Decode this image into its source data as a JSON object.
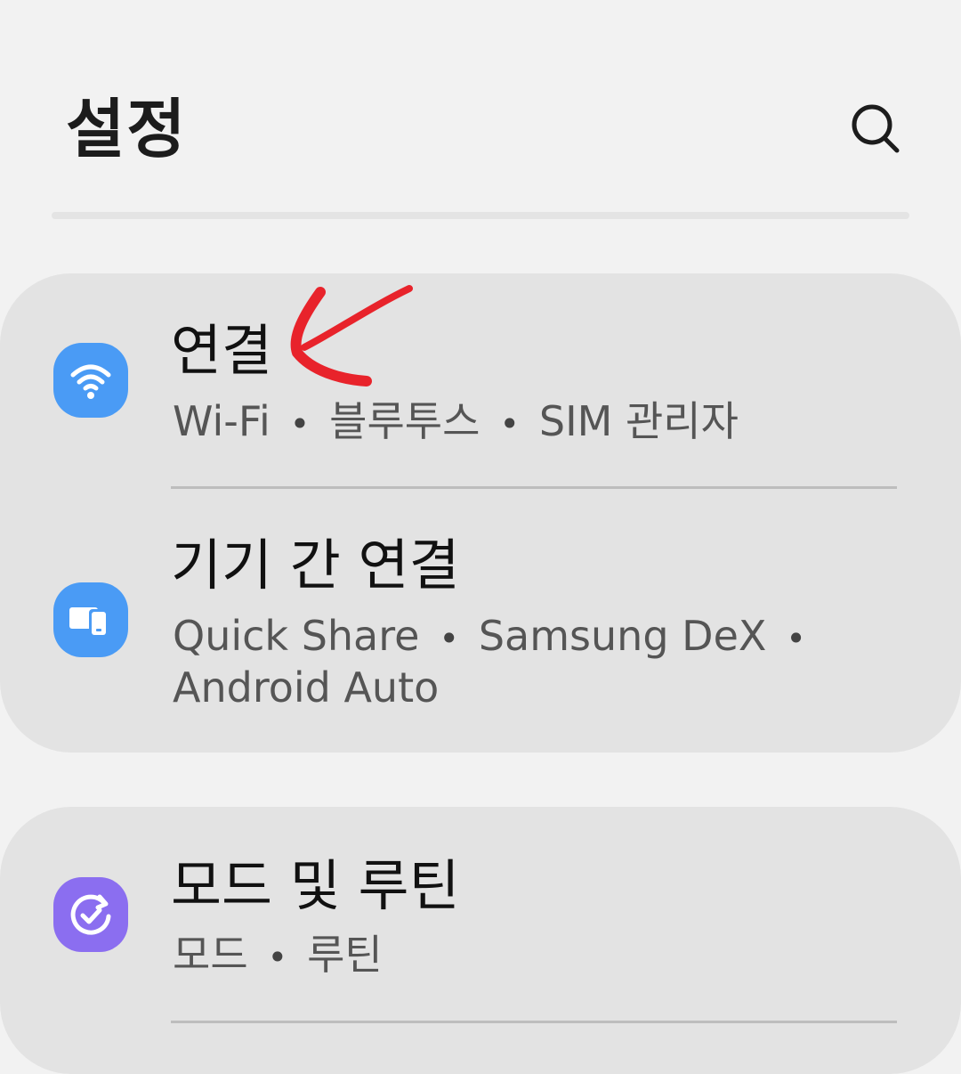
{
  "header": {
    "title": "설정",
    "search_icon": "search-icon"
  },
  "connection": {
    "title": "연결",
    "sub": [
      "Wi-Fi",
      "블루투스",
      "SIM 관리자"
    ],
    "separator": "•",
    "icon": "wifi-icon",
    "icon_color": "#4a9bf5"
  },
  "connected_devices": {
    "title": "기기 간 연결",
    "sub_line1": [
      "Quick Share",
      "Samsung DeX"
    ],
    "sub_line2": "Android Auto",
    "separator": "•",
    "icon": "devices-icon",
    "icon_color": "#4a9bf5"
  },
  "modes": {
    "title": "모드 및 루틴",
    "sub": [
      "모드",
      "루틴"
    ],
    "separator": "•",
    "icon": "routine-check-icon",
    "icon_color": "#8b6ef0"
  },
  "annotation": {
    "icon": "red-arrow-annotation",
    "color": "#e8232b"
  }
}
